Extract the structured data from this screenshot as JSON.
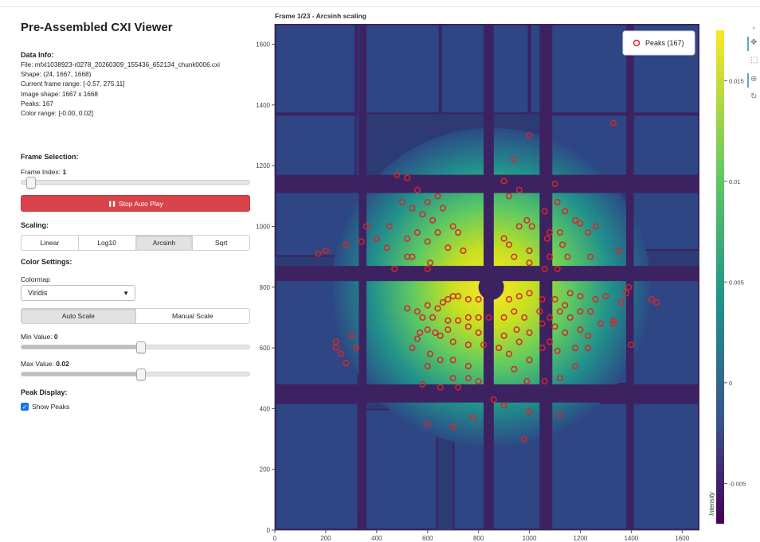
{
  "app": {
    "title": "Pre-Assembled CXI Viewer"
  },
  "data_info": {
    "header": "Data Info:",
    "lines": [
      "File: mfxl1038923-r0278_20260309_155436_652134_chunk0006.cxi",
      "Shape: (24, 1667, 1668)",
      "Current frame range: [-0.57, 275.11]",
      "Image shape: 1667 x 1668",
      "Peaks: 167",
      "Color range: [-0.00, 0.02]"
    ]
  },
  "frame_selection": {
    "header": "Frame Selection:",
    "index_label": "Frame Index: ",
    "index_value": "1",
    "index_fraction": 0.0,
    "play_icon": "pause-icon",
    "play_label": "Stop Auto Play",
    "play_color": "#d9434c"
  },
  "scaling": {
    "header": "Scaling:",
    "options": [
      "Linear",
      "Log10",
      "Arcsinh",
      "Sqrt"
    ],
    "active": "Arcsinh"
  },
  "color_settings": {
    "header": "Color Settings:",
    "colormap_label": "Colormap",
    "colormap_value": "Viridis",
    "scale_modes": [
      "Auto Scale",
      "Manual Scale"
    ],
    "active_scale": "Auto Scale",
    "min_label": "Min Value: ",
    "min_value": "0",
    "min_fraction": 0.5,
    "max_label": "Max Value: ",
    "max_value": "0.02",
    "max_fraction": 0.5
  },
  "peak_display": {
    "header": "Peak Display:",
    "show_peaks_label": "Show Peaks",
    "show_peaks_checked": true
  },
  "plot": {
    "title": "Frame 1/23 - Arcsinh scaling",
    "legend_label": "Peaks (167)",
    "peak_color": "#d62728",
    "x_ticks": [
      "0",
      "200",
      "400",
      "600",
      "800",
      "1000",
      "1200",
      "1400",
      "1600"
    ],
    "y_ticks": [
      "0",
      "200",
      "400",
      "600",
      "800",
      "1000",
      "1200",
      "1400",
      "1600"
    ],
    "x_range": [
      0,
      1668
    ],
    "y_range": [
      0,
      1667
    ],
    "colorbar_ticks": [
      "-0.005",
      "0",
      "0.005",
      "0.01",
      "0.015"
    ],
    "colorbar_range": [
      -0.007,
      0.0175
    ],
    "colorbar_label": "Intensity",
    "colormap": "viridis",
    "toolbar_icons": [
      "logo-icon",
      "pan-icon",
      "box-zoom-icon",
      "wheel-zoom-icon",
      "reset-icon"
    ]
  }
}
